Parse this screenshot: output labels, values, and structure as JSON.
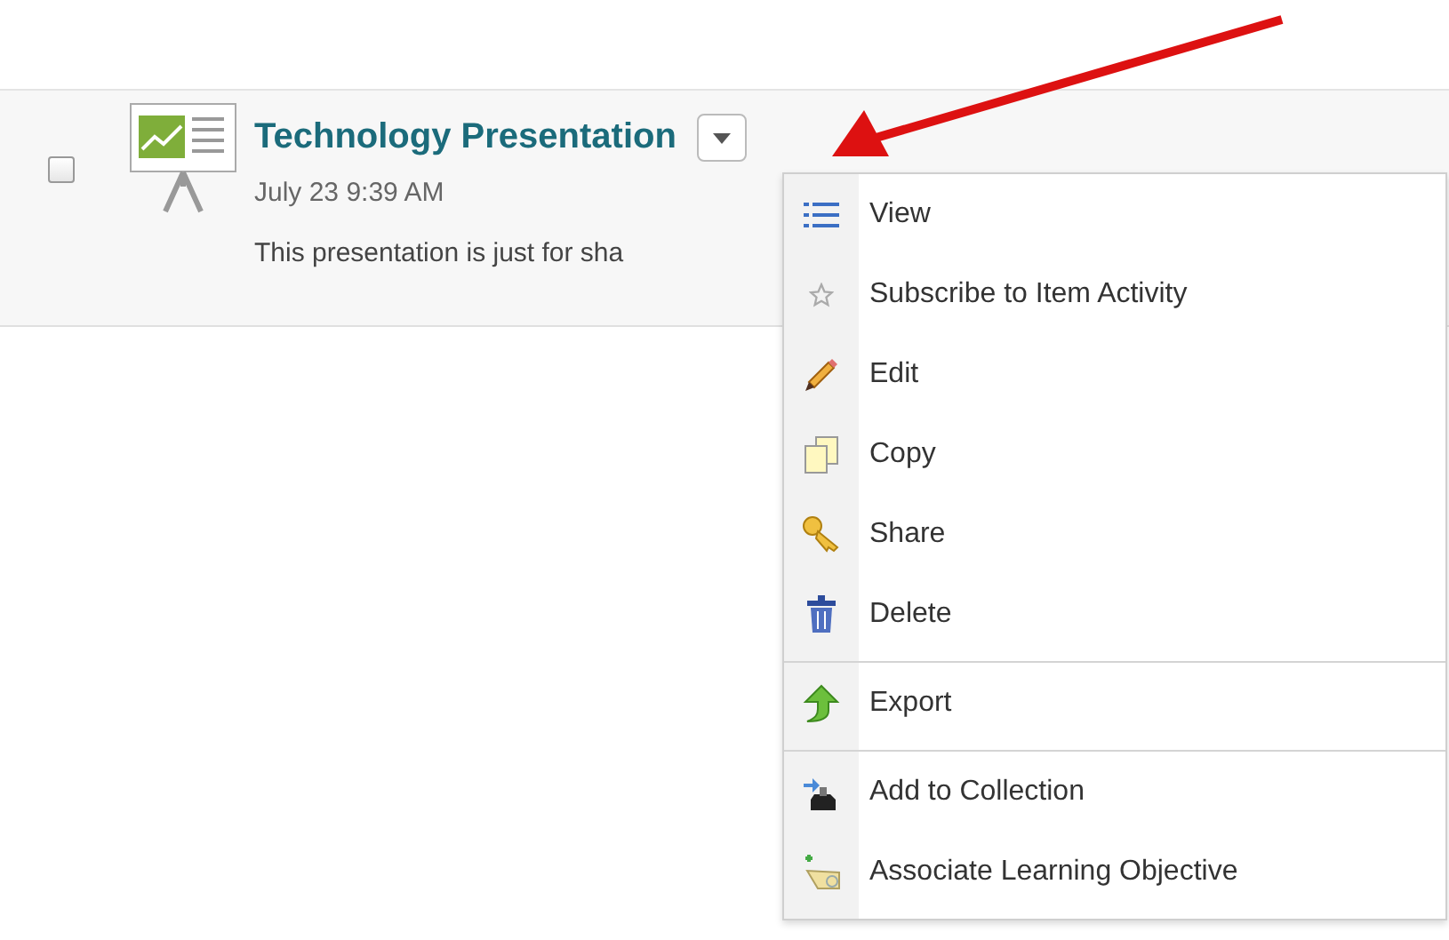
{
  "item": {
    "checked": false,
    "title": "Technology Presentation",
    "date": "July 23 9:39 AM",
    "description": "This presentation is just for sha"
  },
  "menu": [
    {
      "label": "View",
      "separator_before": false
    },
    {
      "label": "Subscribe to Item Activity",
      "separator_before": false
    },
    {
      "label": "Edit",
      "separator_before": false
    },
    {
      "label": "Copy",
      "separator_before": false
    },
    {
      "label": "Share",
      "separator_before": false
    },
    {
      "label": "Delete",
      "separator_before": false
    },
    {
      "label": "Export",
      "separator_before": true
    },
    {
      "label": "Add to Collection",
      "separator_before": true
    },
    {
      "label": "Associate Learning Objective",
      "separator_before": false
    }
  ]
}
